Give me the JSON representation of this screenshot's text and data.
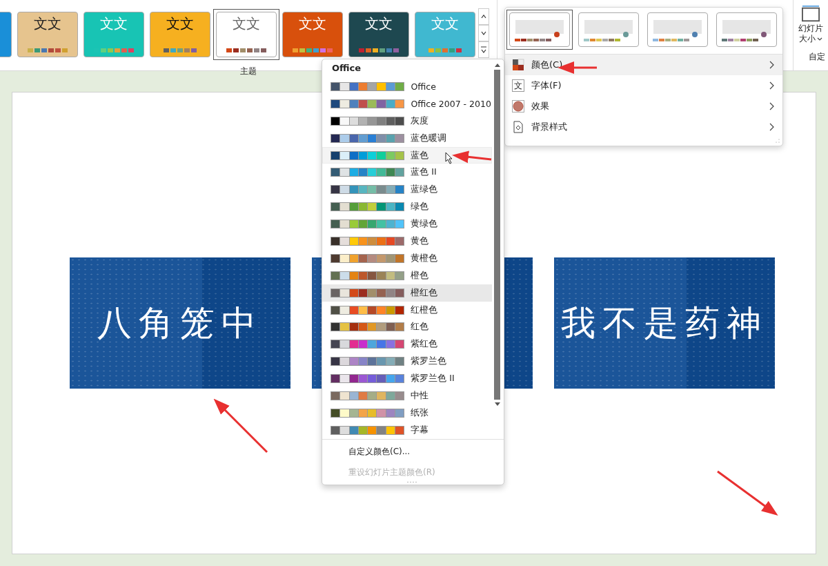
{
  "ribbon": {
    "themes": [
      {
        "color": "#1a8fd8",
        "selected": false
      },
      {
        "label": "文文",
        "label_style": {
          "color": "#222222"
        },
        "color": "#e6c48e",
        "selected": false,
        "swatches": [
          {
            "color": "#c9b04a"
          },
          {
            "color": "#3a9a78"
          },
          {
            "color": "#4a78b0"
          },
          {
            "color": "#b04a3a"
          },
          {
            "color": "#c0503c"
          },
          {
            "color": "#d0a030"
          }
        ]
      },
      {
        "label": "文文",
        "label_style": {
          "color": "#ffffff"
        },
        "color": "#18c4b4",
        "selected": false,
        "swatches": [
          {
            "color": "#1cc4b4"
          },
          {
            "color": "#60d080"
          },
          {
            "color": "#90c850"
          },
          {
            "color": "#e0a040"
          },
          {
            "color": "#e06050"
          },
          {
            "color": "#e04060"
          }
        ]
      },
      {
        "label": "文文",
        "label_style": {
          "color": "#111111"
        },
        "color": "#f6b020",
        "selected": false,
        "swatches": [
          {
            "color": "#606060"
          },
          {
            "color": "#40a8c0"
          },
          {
            "color": "#70a080"
          },
          {
            "color": "#a08060"
          },
          {
            "color": "#8060a0"
          }
        ]
      },
      {
        "label": "文文",
        "label_style": {
          "color": "#666666"
        },
        "color": "#ffffff",
        "selected": true,
        "swatches": [
          {
            "color": "#d34817"
          },
          {
            "color": "#9b2d1f"
          },
          {
            "color": "#a28e6a"
          },
          {
            "color": "#956251"
          },
          {
            "color": "#918485"
          },
          {
            "color": "#855d5d"
          }
        ]
      },
      {
        "label": "文文",
        "label_style": {
          "color": "#ffffff"
        },
        "color": "#d8500c",
        "selected": false,
        "swatches": [
          {
            "color": "#f0a030"
          },
          {
            "color": "#c0c040"
          },
          {
            "color": "#40b080"
          },
          {
            "color": "#40a0d0"
          },
          {
            "color": "#d070e0"
          },
          {
            "color": "#f06060"
          }
        ]
      },
      {
        "label": "文文",
        "label_style": {
          "color": "#ffffff"
        },
        "color": "#1e4850",
        "selected": false,
        "swatches": [
          {
            "color": "#c02030"
          },
          {
            "color": "#e06020"
          },
          {
            "color": "#f0b020"
          },
          {
            "color": "#60a080"
          },
          {
            "color": "#4080b0"
          },
          {
            "color": "#9060a0"
          }
        ]
      },
      {
        "label": "文文",
        "label_style": {
          "color": "#ffffff"
        },
        "color": "#40b8d0",
        "selected": false,
        "swatches": [
          {
            "color": "#f0b020"
          },
          {
            "color": "#90c040"
          },
          {
            "color": "#e07030"
          },
          {
            "color": "#30a080"
          },
          {
            "color": "#d03040"
          }
        ]
      }
    ],
    "themes_group_label": "主题",
    "slide_size": {
      "line1": "幻灯片",
      "line2": "大小"
    },
    "customize_group_label": "自定"
  },
  "variants_panel": {
    "variants": [
      {
        "selected": true,
        "color": "#c8401c",
        "swatches": [
          {
            "color": "#d34817"
          },
          {
            "color": "#9b2d1f"
          },
          {
            "color": "#a28e6a"
          },
          {
            "color": "#956251"
          },
          {
            "color": "#918485"
          },
          {
            "color": "#855d5d"
          }
        ]
      },
      {
        "selected": false,
        "color": "#6a9a98",
        "swatches": [
          {
            "color": "#a0c8c8"
          },
          {
            "color": "#e08830"
          },
          {
            "color": "#e0c850"
          },
          {
            "color": "#a8a8a8"
          },
          {
            "color": "#907860"
          },
          {
            "color": "#b0b830"
          }
        ]
      },
      {
        "selected": false,
        "color": "#5080b0",
        "swatches": [
          {
            "color": "#90b8e0"
          },
          {
            "color": "#e08040"
          },
          {
            "color": "#a8b080"
          },
          {
            "color": "#e0b860"
          },
          {
            "color": "#70b0a0"
          },
          {
            "color": "#a09898"
          }
        ]
      },
      {
        "selected": false,
        "color": "#805878",
        "swatches": [
          {
            "color": "#607878"
          },
          {
            "color": "#a080a0"
          },
          {
            "color": "#d0d0a0"
          },
          {
            "color": "#b04070"
          },
          {
            "color": "#90a060"
          },
          {
            "color": "#706050"
          }
        ]
      }
    ],
    "items": [
      {
        "kind": "colors",
        "label": "颜色(C)",
        "selected": true
      },
      {
        "kind": "fonts",
        "label": "字体(F)",
        "icon_text": "文",
        "selected": false
      },
      {
        "kind": "effects",
        "label": "效果",
        "selected": false
      },
      {
        "kind": "background",
        "label": "背景样式",
        "selected": false
      }
    ]
  },
  "colors_menu": {
    "heading": "Office",
    "schemes": [
      {
        "name": "Office",
        "selected": false,
        "hovered": false,
        "swatches": [
          {
            "color": "#44546a"
          },
          {
            "color": "#e7e6e6"
          },
          {
            "color": "#4472c4"
          },
          {
            "color": "#ed7d31"
          },
          {
            "color": "#a5a5a5"
          },
          {
            "color": "#ffc000"
          },
          {
            "color": "#5b9bd5"
          },
          {
            "color": "#70ad47"
          }
        ]
      },
      {
        "name": "Office 2007 - 2010",
        "selected": false,
        "hovered": false,
        "swatches": [
          {
            "color": "#1f497d"
          },
          {
            "color": "#eeece1"
          },
          {
            "color": "#4f81bd"
          },
          {
            "color": "#c0504d"
          },
          {
            "color": "#9bbb59"
          },
          {
            "color": "#8064a2"
          },
          {
            "color": "#4bacc6"
          },
          {
            "color": "#f79646"
          }
        ]
      },
      {
        "name": "灰度",
        "selected": false,
        "hovered": false,
        "swatches": [
          {
            "color": "#000000"
          },
          {
            "color": "#f8f8f8"
          },
          {
            "color": "#dddddd"
          },
          {
            "color": "#b2b2b2"
          },
          {
            "color": "#969696"
          },
          {
            "color": "#808080"
          },
          {
            "color": "#5f5f5f"
          },
          {
            "color": "#4d4d4d"
          }
        ]
      },
      {
        "name": "蓝色暖调",
        "selected": false,
        "hovered": false,
        "swatches": [
          {
            "color": "#242852"
          },
          {
            "color": "#acccea"
          },
          {
            "color": "#4a66ac"
          },
          {
            "color": "#629dd1"
          },
          {
            "color": "#297fd5"
          },
          {
            "color": "#7f8fa9"
          },
          {
            "color": "#5aa2ae"
          },
          {
            "color": "#9d90a0"
          }
        ]
      },
      {
        "name": "蓝色",
        "selected": false,
        "hovered": true,
        "swatches": [
          {
            "color": "#17406d"
          },
          {
            "color": "#dbeff9"
          },
          {
            "color": "#0f6fc6"
          },
          {
            "color": "#009dd9"
          },
          {
            "color": "#0bd0d9"
          },
          {
            "color": "#10cf9b"
          },
          {
            "color": "#7cca62"
          },
          {
            "color": "#a5c249"
          }
        ]
      },
      {
        "name": "蓝色 II",
        "selected": false,
        "hovered": false,
        "swatches": [
          {
            "color": "#335b74"
          },
          {
            "color": "#dfe3e5"
          },
          {
            "color": "#1cade4"
          },
          {
            "color": "#2683c6"
          },
          {
            "color": "#27ced7"
          },
          {
            "color": "#42ba97"
          },
          {
            "color": "#3e8853"
          },
          {
            "color": "#62a39f"
          }
        ]
      },
      {
        "name": "蓝绿色",
        "selected": false,
        "hovered": false,
        "swatches": [
          {
            "color": "#373545"
          },
          {
            "color": "#cedbe6"
          },
          {
            "color": "#3494ba"
          },
          {
            "color": "#58b6c0"
          },
          {
            "color": "#75bda7"
          },
          {
            "color": "#7a8c8e"
          },
          {
            "color": "#84acb6"
          },
          {
            "color": "#2683c6"
          }
        ]
      },
      {
        "name": "绿色",
        "selected": false,
        "hovered": false,
        "swatches": [
          {
            "color": "#455f51"
          },
          {
            "color": "#e3ded1"
          },
          {
            "color": "#549e39"
          },
          {
            "color": "#8ab833"
          },
          {
            "color": "#c0cf3a"
          },
          {
            "color": "#029676"
          },
          {
            "color": "#4ab5c4"
          },
          {
            "color": "#0989b1"
          }
        ]
      },
      {
        "name": "黄绿色",
        "selected": false,
        "hovered": false,
        "swatches": [
          {
            "color": "#455f51"
          },
          {
            "color": "#e3ded1"
          },
          {
            "color": "#99cb38"
          },
          {
            "color": "#63a537"
          },
          {
            "color": "#37a76f"
          },
          {
            "color": "#44c1a3"
          },
          {
            "color": "#4eb3cf"
          },
          {
            "color": "#51c3f9"
          }
        ]
      },
      {
        "name": "黄色",
        "selected": false,
        "hovered": false,
        "swatches": [
          {
            "color": "#39302a"
          },
          {
            "color": "#e5dedb"
          },
          {
            "color": "#ffca08"
          },
          {
            "color": "#f8931d"
          },
          {
            "color": "#ce8d3e"
          },
          {
            "color": "#ec7016"
          },
          {
            "color": "#e64823"
          },
          {
            "color": "#9c6a6a"
          }
        ]
      },
      {
        "name": "黄橙色",
        "selected": false,
        "hovered": false,
        "swatches": [
          {
            "color": "#4e3b30"
          },
          {
            "color": "#fbeec9"
          },
          {
            "color": "#f0a22e"
          },
          {
            "color": "#a5644e"
          },
          {
            "color": "#b58b80"
          },
          {
            "color": "#c3986d"
          },
          {
            "color": "#a19574"
          },
          {
            "color": "#c17529"
          }
        ]
      },
      {
        "name": "橙色",
        "selected": false,
        "hovered": false,
        "swatches": [
          {
            "color": "#637052"
          },
          {
            "color": "#ccddea"
          },
          {
            "color": "#e48312"
          },
          {
            "color": "#bd582c"
          },
          {
            "color": "#865640"
          },
          {
            "color": "#9b8357"
          },
          {
            "color": "#c2bc80"
          },
          {
            "color": "#94a088"
          }
        ]
      },
      {
        "name": "橙红色",
        "selected": true,
        "hovered": false,
        "swatches": [
          {
            "color": "#696464"
          },
          {
            "color": "#e9e5dc"
          },
          {
            "color": "#d34817"
          },
          {
            "color": "#9b2d1f"
          },
          {
            "color": "#a28e6a"
          },
          {
            "color": "#956251"
          },
          {
            "color": "#918485"
          },
          {
            "color": "#855d5d"
          }
        ]
      },
      {
        "name": "红橙色",
        "selected": false,
        "hovered": false,
        "swatches": [
          {
            "color": "#505046"
          },
          {
            "color": "#eeece1"
          },
          {
            "color": "#e84c22"
          },
          {
            "color": "#ffbd47"
          },
          {
            "color": "#b64926"
          },
          {
            "color": "#ff8427"
          },
          {
            "color": "#cc9900"
          },
          {
            "color": "#b22600"
          }
        ]
      },
      {
        "name": "红色",
        "selected": false,
        "hovered": false,
        "swatches": [
          {
            "color": "#323232"
          },
          {
            "color": "#e5c243"
          },
          {
            "color": "#a5300f"
          },
          {
            "color": "#d55816"
          },
          {
            "color": "#e19825"
          },
          {
            "color": "#b19c7d"
          },
          {
            "color": "#7f5f52"
          },
          {
            "color": "#b27d49"
          }
        ]
      },
      {
        "name": "紫红色",
        "selected": false,
        "hovered": false,
        "swatches": [
          {
            "color": "#454551"
          },
          {
            "color": "#d8d9dc"
          },
          {
            "color": "#e32d91"
          },
          {
            "color": "#c830cc"
          },
          {
            "color": "#4ea6dc"
          },
          {
            "color": "#4775e7"
          },
          {
            "color": "#8971e1"
          },
          {
            "color": "#d54773"
          }
        ]
      },
      {
        "name": "紫罗兰色",
        "selected": false,
        "hovered": false,
        "swatches": [
          {
            "color": "#373545"
          },
          {
            "color": "#dcd8dc"
          },
          {
            "color": "#ad84c6"
          },
          {
            "color": "#8784c7"
          },
          {
            "color": "#5d739a"
          },
          {
            "color": "#6997af"
          },
          {
            "color": "#84acb6"
          },
          {
            "color": "#6f8183"
          }
        ]
      },
      {
        "name": "紫罗兰色 II",
        "selected": false,
        "hovered": false,
        "swatches": [
          {
            "color": "#632e62"
          },
          {
            "color": "#eae5eb"
          },
          {
            "color": "#92278f"
          },
          {
            "color": "#9b57d3"
          },
          {
            "color": "#755dd9"
          },
          {
            "color": "#665eb8"
          },
          {
            "color": "#45a5ed"
          },
          {
            "color": "#5982db"
          }
        ]
      },
      {
        "name": "中性",
        "selected": false,
        "hovered": false,
        "swatches": [
          {
            "color": "#7a6a60"
          },
          {
            "color": "#efe4d0"
          },
          {
            "color": "#9ab5d4"
          },
          {
            "color": "#e07b44"
          },
          {
            "color": "#a5ad86"
          },
          {
            "color": "#dfb55f"
          },
          {
            "color": "#7ea89b"
          },
          {
            "color": "#988c8d"
          }
        ]
      },
      {
        "name": "纸张",
        "selected": false,
        "hovered": false,
        "swatches": [
          {
            "color": "#444d26"
          },
          {
            "color": "#fefac9"
          },
          {
            "color": "#a5b592"
          },
          {
            "color": "#f3a447"
          },
          {
            "color": "#e7bc29"
          },
          {
            "color": "#d092a7"
          },
          {
            "color": "#9c85c0"
          },
          {
            "color": "#809ec2"
          }
        ]
      },
      {
        "name": "字幕",
        "selected": false,
        "hovered": false,
        "swatches": [
          {
            "color": "#5f5f5f"
          },
          {
            "color": "#dddddd"
          },
          {
            "color": "#418ab3"
          },
          {
            "color": "#a6b727"
          },
          {
            "color": "#f69200"
          },
          {
            "color": "#838383"
          },
          {
            "color": "#fec306"
          },
          {
            "color": "#df5327"
          }
        ]
      }
    ],
    "footer": [
      {
        "label": "自定义颜色(C)...",
        "disabled": false
      },
      {
        "label": "重设幻灯片主题颜色(R)",
        "disabled": true
      }
    ]
  },
  "slide": {
    "cards": [
      {
        "kind": "title_card",
        "title": "八角笼中"
      },
      {
        "kind": "title_card"
      },
      {
        "kind": "title_card",
        "title": "我不是药神"
      }
    ]
  }
}
